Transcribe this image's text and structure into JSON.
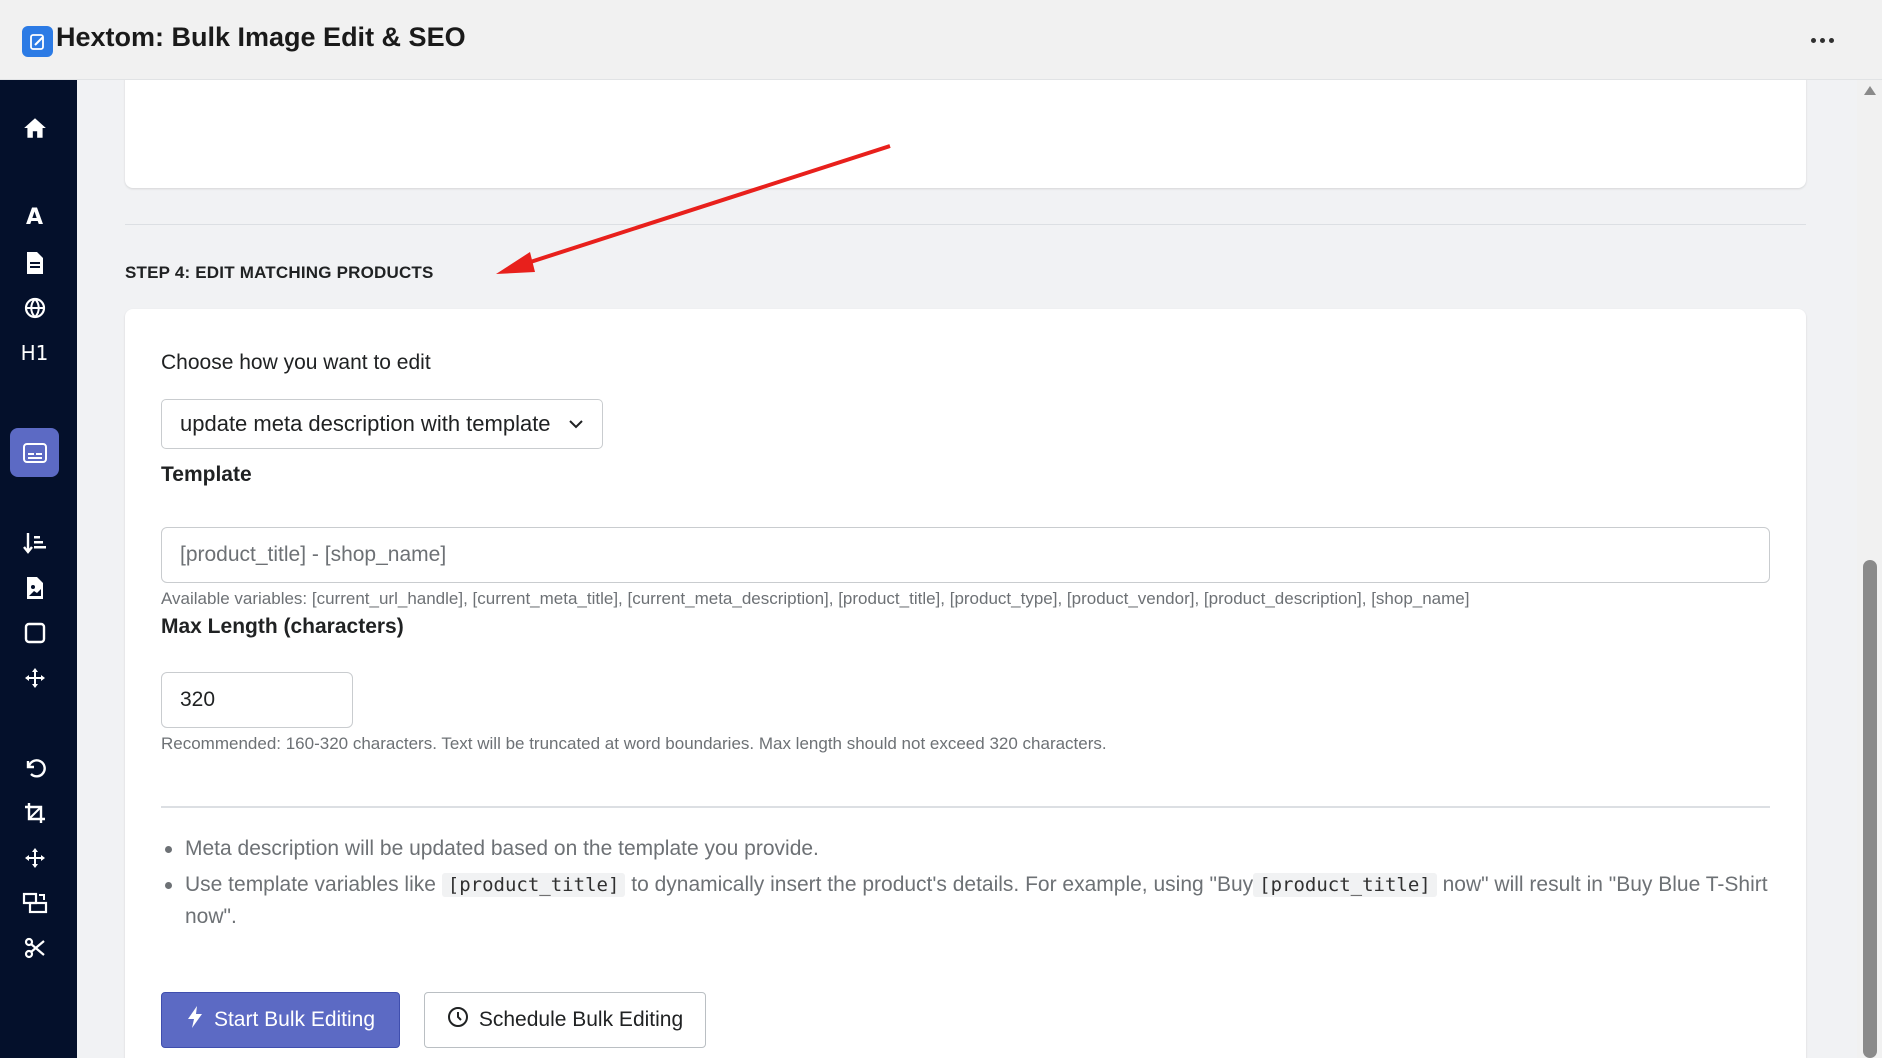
{
  "app": {
    "title": "Hextom: Bulk Image Edit & SEO"
  },
  "sidebar": {
    "items": [
      {
        "name": "home",
        "label": ""
      },
      {
        "name": "alt-text",
        "label": "A"
      },
      {
        "name": "file",
        "label": ""
      },
      {
        "name": "globe",
        "label": ""
      },
      {
        "name": "h1",
        "label": "H1"
      },
      {
        "name": "meta",
        "label": ""
      },
      {
        "name": "sort",
        "label": ""
      },
      {
        "name": "image-file",
        "label": ""
      },
      {
        "name": "square",
        "label": ""
      },
      {
        "name": "move",
        "label": ""
      },
      {
        "name": "undo",
        "label": ""
      },
      {
        "name": "crop",
        "label": ""
      },
      {
        "name": "move2",
        "label": ""
      },
      {
        "name": "resize",
        "label": ""
      },
      {
        "name": "scissors",
        "label": ""
      }
    ]
  },
  "step": {
    "heading": "STEP 4: EDIT MATCHING PRODUCTS"
  },
  "form": {
    "choose_label": "Choose how you want to edit",
    "select_value": "update meta description with template",
    "template_label": "Template",
    "template_placeholder": "[product_title] - [shop_name]",
    "template_help": "Available variables: [current_url_handle], [current_meta_title], [current_meta_description], [product_title], [product_type], [product_vendor], [product_description], [shop_name]",
    "maxlen_label": "Max Length (characters)",
    "maxlen_value": "320",
    "maxlen_help": "Recommended: 160-320 characters. Text will be truncated at word boundaries. Max length should not exceed 320 characters."
  },
  "notes": {
    "note1": "Meta description will be updated based on the template you provide.",
    "note2_a": "Use template variables like",
    "note2_code1": "[product_title]",
    "note2_b": "to dynamically insert the product's details. For example, using \"Buy",
    "note2_code2": "[product_title]",
    "note2_c": "now\" will result in \"Buy Blue T-Shirt now\"."
  },
  "buttons": {
    "start": "Start Bulk Editing",
    "schedule": "Schedule Bulk Editing"
  },
  "colors": {
    "sidebar_bg": "#04102b",
    "accent": "#5c6ac4",
    "annotation_arrow": "#e8201c"
  }
}
